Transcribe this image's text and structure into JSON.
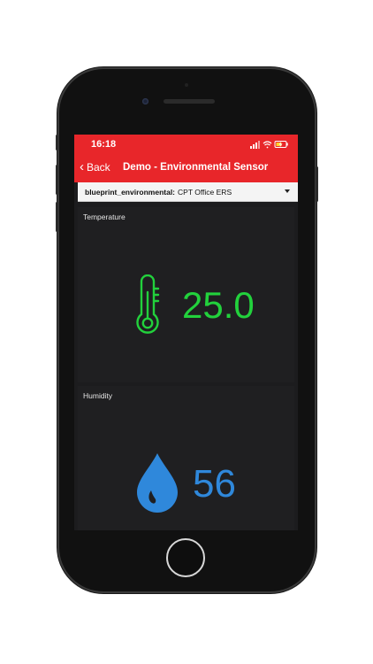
{
  "status": {
    "time": "16:18"
  },
  "nav": {
    "back_label": "Back",
    "title": "Demo - Environmental Sensor"
  },
  "selector": {
    "label": "blueprint_environmental:",
    "value": "CPT Office ERS"
  },
  "temperature": {
    "title": "Temperature",
    "value": "25.0",
    "color": "#22d13c",
    "icon": "thermometer-icon"
  },
  "humidity": {
    "title": "Humidity",
    "value": "56",
    "color": "#2f88db",
    "icon": "water-drop-icon"
  },
  "colors": {
    "header": "#e8262a",
    "background": "#1c1c1e"
  }
}
